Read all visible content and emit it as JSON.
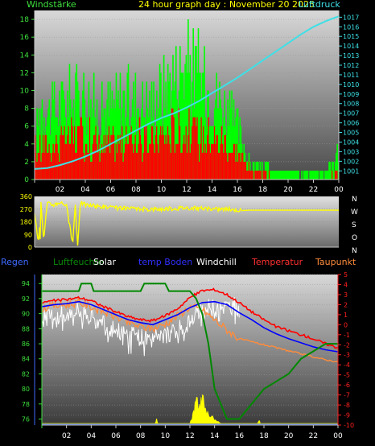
{
  "header": {
    "left_label": "Windstärke",
    "title": "24 hour graph day : November 20 2025",
    "right_label": "Luftdruck"
  },
  "mid_right_labels": [
    "N",
    "W",
    "S",
    "O",
    "N"
  ],
  "legend": [
    "Regen",
    "Luftfeuchte",
    "Solar",
    "temp Boden",
    "Windchill",
    "Temperatur",
    "Taupunkt"
  ],
  "colors": {
    "wind_max": "#00ff00",
    "wind_avg": "#ff0000",
    "pressure": "#3ee0e6",
    "winddir": "#ffff00",
    "humidity": "#008800",
    "solar": "#ffff00",
    "soil": "#0000ff",
    "windchill": "#ffffff",
    "temperature": "#ff0000",
    "dewpoint": "#ff8c3c",
    "axis_left": "#3ee03e",
    "axis_right": "#3ee0e6",
    "regen": "#3e6aff",
    "temp_axis": "#ff2020"
  },
  "chart_data": [
    {
      "type": "line",
      "title": "24 hour graph day : November 20 2025",
      "ylabel": "Windstärke",
      "y2label": "Luftdruck",
      "xticks": [
        "02",
        "04",
        "06",
        "08",
        "10",
        "12",
        "14",
        "16",
        "18",
        "20",
        "22",
        "00"
      ],
      "yticks": [
        "0",
        "2",
        "4",
        "6",
        "8",
        "10",
        "12",
        "14",
        "16",
        "18"
      ],
      "y2ticks": [
        "1001",
        "1002",
        "1003",
        "1004",
        "1005",
        "1006",
        "1007",
        "1008",
        "1009",
        "1010",
        "1011",
        "1012",
        "1013",
        "1014",
        "1015",
        "1016",
        "1017"
      ],
      "ylim": [
        0,
        19
      ],
      "y2lim": [
        1000.1,
        1017.7
      ],
      "series": [
        {
          "name": "Windstärke",
          "key": "wind_max",
          "x": [
            0,
            0.5,
            1,
            2,
            3,
            4,
            5,
            6,
            7,
            8,
            9,
            10,
            11,
            12,
            13,
            14,
            15,
            16,
            16.5,
            17,
            18,
            19,
            20,
            21,
            22,
            23,
            24
          ],
          "y": [
            4,
            11,
            9,
            10,
            11,
            12,
            9,
            10,
            11,
            11,
            10,
            12,
            14,
            16,
            14,
            12,
            10,
            7,
            5,
            2,
            2,
            1,
            1,
            1,
            1,
            1,
            4
          ]
        },
        {
          "name": "avg",
          "key": "wind_avg",
          "x": [
            0,
            1,
            2,
            3,
            4,
            5,
            6,
            7,
            8,
            9,
            10,
            11,
            12,
            13,
            14,
            15,
            16,
            16.5,
            17,
            18,
            19,
            20,
            21,
            22,
            23,
            24
          ],
          "y": [
            4,
            5,
            5,
            6,
            6,
            5,
            5,
            5,
            6,
            5,
            6,
            7,
            7,
            6,
            6,
            5,
            4,
            3,
            1,
            1,
            0,
            0,
            0,
            0,
            0,
            1
          ]
        },
        {
          "name": "Luftdruck",
          "key": "pressure",
          "axis": "y2",
          "x": [
            0,
            1,
            2,
            3,
            4,
            5,
            6,
            7,
            8,
            9,
            10,
            11,
            12,
            13,
            14,
            15,
            16,
            17,
            18,
            19,
            20,
            21,
            22,
            23,
            24
          ],
          "y": [
            1001.2,
            1001.3,
            1001.6,
            1002.0,
            1002.5,
            1003.1,
            1003.8,
            1004.5,
            1005.2,
            1005.9,
            1006.5,
            1007.0,
            1007.6,
            1008.3,
            1009.1,
            1009.9,
            1010.7,
            1011.6,
            1012.5,
            1013.4,
            1014.3,
            1015.2,
            1016.0,
            1016.6,
            1017.1
          ]
        }
      ]
    },
    {
      "type": "line",
      "title": "",
      "yticks": [
        "0",
        "90",
        "180",
        "270",
        "360"
      ],
      "ylim": [
        0,
        360
      ],
      "series": [
        {
          "name": "winddir",
          "key": "winddir",
          "x": [
            0,
            0.3,
            0.5,
            0.7,
            1,
            1.5,
            2,
            2.5,
            3,
            3.2,
            3.4,
            3.6,
            4,
            5,
            6,
            7,
            8,
            9,
            10,
            11,
            12,
            13,
            14,
            15,
            16,
            16.3,
            17,
            18,
            19,
            20,
            21,
            22,
            23,
            24
          ],
          "y": [
            250,
            30,
            340,
            50,
            310,
            300,
            320,
            300,
            20,
            300,
            10,
            320,
            300,
            290,
            280,
            275,
            270,
            270,
            270,
            275,
            280,
            275,
            270,
            270,
            265,
            260,
            262,
            262,
            262,
            262,
            262,
            262,
            262,
            262
          ]
        }
      ]
    },
    {
      "type": "line",
      "title": "",
      "yticks": [
        "76",
        "78",
        "80",
        "82",
        "84",
        "86",
        "88",
        "90",
        "92",
        "94"
      ],
      "y2ticks": [
        "5",
        "4",
        "3",
        "2",
        "1",
        "0",
        "-1",
        "-2",
        "-3",
        "-4",
        "-5",
        "-6",
        "-7",
        "-8",
        "-9",
        "-10"
      ],
      "ylim": [
        75.2,
        95.2
      ],
      "y2lim": [
        -10,
        5
      ],
      "legend": "top",
      "series": [
        {
          "name": "Luftfeuchte",
          "key": "humidity",
          "x": [
            0,
            3,
            3.2,
            4,
            4.2,
            8,
            8.3,
            10,
            10.3,
            12,
            12.5,
            13,
            13.5,
            14,
            15,
            16,
            17,
            18,
            19,
            20,
            21,
            22,
            23,
            24
          ],
          "y": [
            93,
            93,
            94,
            94,
            93,
            93,
            94,
            94,
            93,
            93,
            92,
            90,
            86,
            80,
            76,
            76,
            78,
            80,
            81,
            82,
            84,
            85,
            86,
            86
          ]
        },
        {
          "name": "temp Boden",
          "key": "soil",
          "axis": "y2",
          "x": [
            0,
            1,
            2,
            3,
            4,
            5,
            6,
            7,
            8,
            9,
            10,
            11,
            12,
            13,
            14,
            15,
            16,
            17,
            18,
            19,
            20,
            21,
            22,
            23,
            24
          ],
          "y": [
            1.8,
            2.0,
            2.1,
            2.3,
            2.0,
            1.5,
            1.0,
            0.5,
            0.2,
            0.0,
            0.5,
            1.0,
            1.7,
            2.2,
            2.3,
            2.0,
            1.2,
            0.5,
            -0.3,
            -0.9,
            -1.4,
            -1.8,
            -2.2,
            -2.5,
            -2.7
          ]
        },
        {
          "name": "Temperatur",
          "key": "temperature",
          "axis": "y2",
          "x": [
            0,
            1,
            2,
            3,
            4,
            5,
            6,
            7,
            8,
            9,
            10,
            11,
            12,
            13,
            14,
            15,
            16,
            17,
            18,
            19,
            20,
            21,
            22,
            23,
            24
          ],
          "y": [
            2.2,
            2.4,
            2.5,
            2.7,
            2.4,
            1.8,
            1.3,
            0.8,
            0.5,
            0.4,
            0.9,
            1.6,
            2.7,
            3.4,
            3.5,
            3.0,
            2.2,
            1.3,
            0.5,
            -0.2,
            -0.6,
            -1.0,
            -1.4,
            -1.9,
            -2.3
          ]
        },
        {
          "name": "Windchill",
          "key": "windchill",
          "axis": "y2",
          "x": [
            0,
            1,
            2,
            3,
            4,
            5,
            6,
            7,
            8,
            9,
            10,
            11,
            12,
            13,
            14,
            15,
            16
          ],
          "y": [
            0.5,
            1.0,
            1.2,
            1.5,
            0.8,
            0.0,
            -0.5,
            -1.0,
            -1.3,
            -1.4,
            -1.0,
            -0.5,
            0.5,
            1.5,
            2.0,
            1.8,
            2.0
          ]
        },
        {
          "name": "Taupunkt",
          "key": "dewpoint",
          "axis": "y2",
          "x": [
            0,
            1,
            2,
            3,
            4,
            5,
            6,
            7,
            8,
            9,
            10,
            11,
            12,
            13,
            14,
            15,
            16,
            17,
            18,
            19,
            20,
            21,
            22,
            23,
            24
          ],
          "y": [
            1.6,
            1.9,
            2.0,
            2.2,
            1.8,
            1.3,
            0.8,
            0.2,
            -0.2,
            -0.4,
            0.1,
            0.9,
            1.8,
            1.5,
            0.5,
            -0.5,
            -1.4,
            -1.7,
            -2.0,
            -2.3,
            -2.6,
            -2.9,
            -3.2,
            -3.5,
            -3.7
          ]
        },
        {
          "name": "Solar",
          "key": "solar",
          "x": [
            0,
            9.2,
            9.3,
            9.4,
            12.0,
            12.2,
            12.4,
            12.6,
            12.8,
            13.0,
            13.2,
            13.4,
            13.6,
            13.8,
            14.0,
            14.5,
            17.5,
            17.6,
            17.7,
            24
          ],
          "y": [
            0,
            0,
            2,
            0,
            0,
            4,
            9,
            12,
            9,
            13,
            10,
            6,
            3,
            5,
            2,
            0,
            0,
            2,
            0,
            0
          ]
        }
      ]
    }
  ]
}
